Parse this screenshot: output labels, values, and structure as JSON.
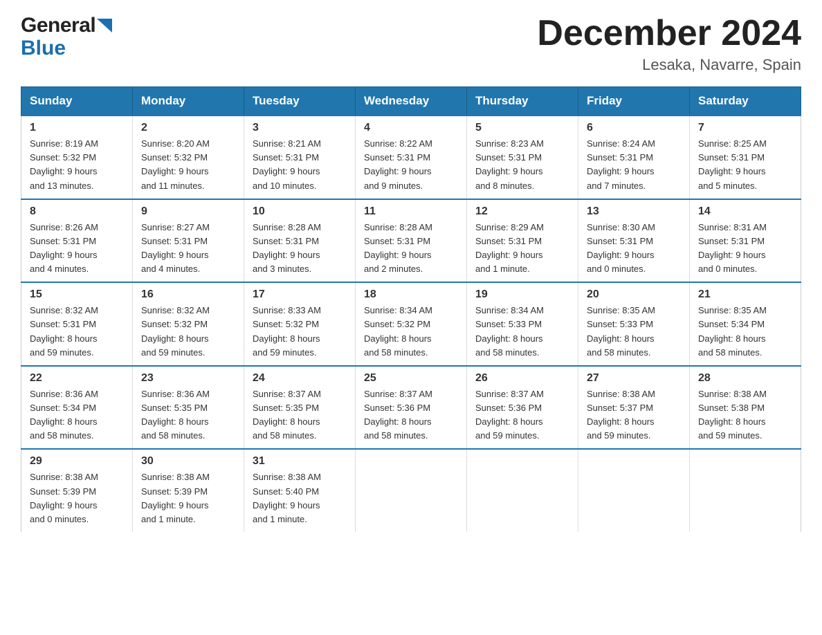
{
  "logo": {
    "line1": "General",
    "line2": "Blue"
  },
  "title": "December 2024",
  "location": "Lesaka, Navarre, Spain",
  "weekdays": [
    "Sunday",
    "Monday",
    "Tuesday",
    "Wednesday",
    "Thursday",
    "Friday",
    "Saturday"
  ],
  "weeks": [
    [
      {
        "day": "1",
        "sunrise": "8:19 AM",
        "sunset": "5:32 PM",
        "daylight": "9 hours and 13 minutes."
      },
      {
        "day": "2",
        "sunrise": "8:20 AM",
        "sunset": "5:32 PM",
        "daylight": "9 hours and 11 minutes."
      },
      {
        "day": "3",
        "sunrise": "8:21 AM",
        "sunset": "5:31 PM",
        "daylight": "9 hours and 10 minutes."
      },
      {
        "day": "4",
        "sunrise": "8:22 AM",
        "sunset": "5:31 PM",
        "daylight": "9 hours and 9 minutes."
      },
      {
        "day": "5",
        "sunrise": "8:23 AM",
        "sunset": "5:31 PM",
        "daylight": "9 hours and 8 minutes."
      },
      {
        "day": "6",
        "sunrise": "8:24 AM",
        "sunset": "5:31 PM",
        "daylight": "9 hours and 7 minutes."
      },
      {
        "day": "7",
        "sunrise": "8:25 AM",
        "sunset": "5:31 PM",
        "daylight": "9 hours and 5 minutes."
      }
    ],
    [
      {
        "day": "8",
        "sunrise": "8:26 AM",
        "sunset": "5:31 PM",
        "daylight": "9 hours and 4 minutes."
      },
      {
        "day": "9",
        "sunrise": "8:27 AM",
        "sunset": "5:31 PM",
        "daylight": "9 hours and 4 minutes."
      },
      {
        "day": "10",
        "sunrise": "8:28 AM",
        "sunset": "5:31 PM",
        "daylight": "9 hours and 3 minutes."
      },
      {
        "day": "11",
        "sunrise": "8:28 AM",
        "sunset": "5:31 PM",
        "daylight": "9 hours and 2 minutes."
      },
      {
        "day": "12",
        "sunrise": "8:29 AM",
        "sunset": "5:31 PM",
        "daylight": "9 hours and 1 minute."
      },
      {
        "day": "13",
        "sunrise": "8:30 AM",
        "sunset": "5:31 PM",
        "daylight": "9 hours and 0 minutes."
      },
      {
        "day": "14",
        "sunrise": "8:31 AM",
        "sunset": "5:31 PM",
        "daylight": "9 hours and 0 minutes."
      }
    ],
    [
      {
        "day": "15",
        "sunrise": "8:32 AM",
        "sunset": "5:31 PM",
        "daylight": "8 hours and 59 minutes."
      },
      {
        "day": "16",
        "sunrise": "8:32 AM",
        "sunset": "5:32 PM",
        "daylight": "8 hours and 59 minutes."
      },
      {
        "day": "17",
        "sunrise": "8:33 AM",
        "sunset": "5:32 PM",
        "daylight": "8 hours and 59 minutes."
      },
      {
        "day": "18",
        "sunrise": "8:34 AM",
        "sunset": "5:32 PM",
        "daylight": "8 hours and 58 minutes."
      },
      {
        "day": "19",
        "sunrise": "8:34 AM",
        "sunset": "5:33 PM",
        "daylight": "8 hours and 58 minutes."
      },
      {
        "day": "20",
        "sunrise": "8:35 AM",
        "sunset": "5:33 PM",
        "daylight": "8 hours and 58 minutes."
      },
      {
        "day": "21",
        "sunrise": "8:35 AM",
        "sunset": "5:34 PM",
        "daylight": "8 hours and 58 minutes."
      }
    ],
    [
      {
        "day": "22",
        "sunrise": "8:36 AM",
        "sunset": "5:34 PM",
        "daylight": "8 hours and 58 minutes."
      },
      {
        "day": "23",
        "sunrise": "8:36 AM",
        "sunset": "5:35 PM",
        "daylight": "8 hours and 58 minutes."
      },
      {
        "day": "24",
        "sunrise": "8:37 AM",
        "sunset": "5:35 PM",
        "daylight": "8 hours and 58 minutes."
      },
      {
        "day": "25",
        "sunrise": "8:37 AM",
        "sunset": "5:36 PM",
        "daylight": "8 hours and 58 minutes."
      },
      {
        "day": "26",
        "sunrise": "8:37 AM",
        "sunset": "5:36 PM",
        "daylight": "8 hours and 59 minutes."
      },
      {
        "day": "27",
        "sunrise": "8:38 AM",
        "sunset": "5:37 PM",
        "daylight": "8 hours and 59 minutes."
      },
      {
        "day": "28",
        "sunrise": "8:38 AM",
        "sunset": "5:38 PM",
        "daylight": "8 hours and 59 minutes."
      }
    ],
    [
      {
        "day": "29",
        "sunrise": "8:38 AM",
        "sunset": "5:39 PM",
        "daylight": "9 hours and 0 minutes."
      },
      {
        "day": "30",
        "sunrise": "8:38 AM",
        "sunset": "5:39 PM",
        "daylight": "9 hours and 1 minute."
      },
      {
        "day": "31",
        "sunrise": "8:38 AM",
        "sunset": "5:40 PM",
        "daylight": "9 hours and 1 minute."
      },
      null,
      null,
      null,
      null
    ]
  ],
  "labels": {
    "sunrise": "Sunrise:",
    "sunset": "Sunset:",
    "daylight": "Daylight:"
  }
}
